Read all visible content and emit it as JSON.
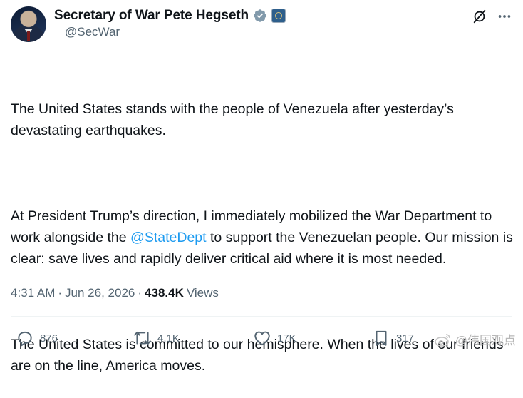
{
  "header": {
    "display_name": "Secretary of War Pete Hegseth",
    "handle": "@SecWar",
    "verified_color": "#829aab"
  },
  "post": {
    "para1": "The United States stands with the people of Venezuela after yesterday’s devastating earthquakes.",
    "para2_before": "At President Trump’s direction, I immediately mobilized the War Department to work alongside the ",
    "para2_mention": "@StateDept",
    "para2_after": " to support the Venezuelan people. Our mission is clear: save lives and rapidly deliver critical aid where it is most needed.",
    "para3": "The United States is committed to our hemisphere. When the lives of our friends are on the line, America moves."
  },
  "meta": {
    "time": "4:31 AM",
    "sep1": "·",
    "date": "Jun 26, 2026",
    "sep2": "·",
    "views_count": "438.4K",
    "views_label": "Views"
  },
  "actions": {
    "replies": "876",
    "reposts": "4.1K",
    "likes": "17K",
    "bookmarks": "317"
  },
  "watermark": {
    "text": "@伟国观点"
  },
  "icons": [
    "verified-badge-icon",
    "government-seal-icon",
    "grok-icon",
    "more-icon",
    "reply-icon",
    "repost-icon",
    "like-icon",
    "bookmark-icon",
    "weibo-icon"
  ],
  "colors": {
    "accent": "#1d9bf0",
    "text": "#0f1419",
    "secondary": "#536471"
  }
}
